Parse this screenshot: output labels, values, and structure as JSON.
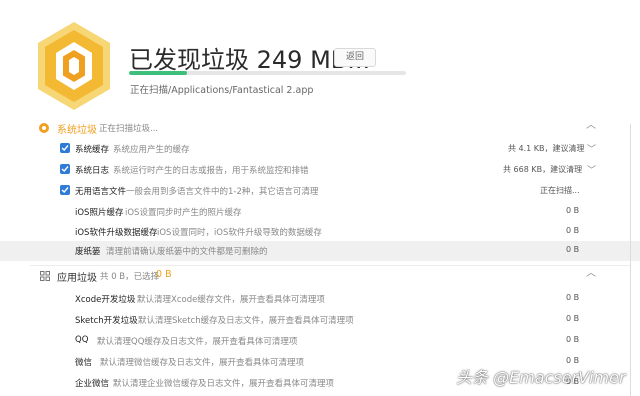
{
  "header": {
    "title": "已发现垃圾 249 MB...",
    "back_label": "返回",
    "progress_fraction": 0.21,
    "scan_path": "正在扫描/Applications/Fantastical 2.app"
  },
  "sections": [
    {
      "title": "系统垃圾",
      "subtitle": "正在扫描垃圾...",
      "accent": "#f0a020",
      "items": [
        {
          "checked": true,
          "name": "系统缓存",
          "desc": "系统应用产生的缓存",
          "size": "共 4.1 KB，建议清理",
          "has_chevron": true
        },
        {
          "checked": true,
          "name": "系统日志",
          "desc": "系统运行时产生的日志或报告，用于系统监控和排错",
          "size": "共 668 KB，建议清理",
          "has_chevron": true
        },
        {
          "checked": true,
          "name": "无用语言文件",
          "desc": "一般会用到多语言文件中的1-2种，其它语言可清理",
          "size": "正在扫描...",
          "has_chevron": false
        },
        {
          "checked": false,
          "name": "iOS照片缓存",
          "desc": "iOS设置同步时产生的照片缓存",
          "size": "0 B",
          "has_chevron": false
        },
        {
          "checked": false,
          "name": "iOS软件升级数据缓存",
          "desc": "iOS设置同时，iOS软件升级导致的数据缓存",
          "size": "0 B",
          "has_chevron": false
        },
        {
          "checked": false,
          "name": "废纸篓",
          "desc": "清理前请确认废纸篓中的文件都是可删除的",
          "size": "0 B",
          "has_chevron": false
        }
      ]
    },
    {
      "title": "应用垃圾",
      "subtitle": "共 0 B，已选择",
      "selected": "0 B",
      "items": [
        {
          "name": "Xcode开发垃圾",
          "desc": "默认清理Xcode缓存文件，展开查看具体可清理项",
          "size": "0 B"
        },
        {
          "name": "Sketch开发垃圾",
          "desc": "默认清理Sketch缓存及日志文件，展开查看具体可清理项",
          "size": "0 B"
        },
        {
          "name": "QQ",
          "desc": "默认清理QQ缓存及日志文件，展开查看具体可清理项",
          "size": "0 B"
        },
        {
          "name": "微信",
          "desc": "默认清理微信缓存及日志文件，展开查看具体可清理项",
          "size": "0 B"
        },
        {
          "name": "企业微信",
          "desc": "默认清理企业微信缓存及日志文件，展开查看具体可清理项",
          "size": "0 B"
        }
      ]
    }
  ],
  "watermark": "头条 @EmacserVimer"
}
